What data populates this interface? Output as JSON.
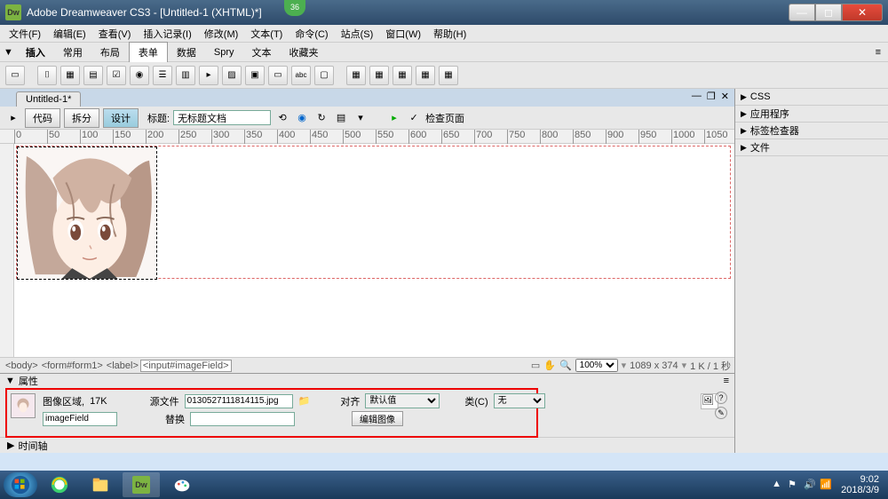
{
  "title": "Adobe Dreamweaver CS3 - [Untitled-1 (XHTML)*]",
  "ribbon_badge": "36",
  "menu": [
    "文件(F)",
    "编辑(E)",
    "查看(V)",
    "插入记录(I)",
    "修改(M)",
    "文本(T)",
    "命令(C)",
    "站点(S)",
    "窗口(W)",
    "帮助(H)"
  ],
  "insert_tabs": {
    "label": "插入",
    "items": [
      "常用",
      "布局",
      "表单",
      "数据",
      "Spry",
      "文本",
      "收藏夹"
    ],
    "active": 2
  },
  "doc_tab": "Untitled-1*",
  "view_buttons": {
    "code": "代码",
    "split": "拆分",
    "design": "设计"
  },
  "doc_toolbar": {
    "title_label": "标题:",
    "title_value": "无标题文档",
    "check_label": "检查页面"
  },
  "ruler_marks": [
    "0",
    "50",
    "100",
    "150",
    "200",
    "250",
    "300",
    "350",
    "400",
    "450",
    "500",
    "550",
    "600",
    "650",
    "700",
    "750",
    "800",
    "850",
    "900",
    "950",
    "1000",
    "1050"
  ],
  "tag_selector": [
    "<body>",
    "<form#form1>",
    "<label>",
    "<input#imageField>"
  ],
  "status": {
    "zoom": "100%",
    "dims": "1089 x 374",
    "extra": "1 K / 1 秒"
  },
  "properties": {
    "header": "属性",
    "area_label": "图像区域,",
    "size": "17K",
    "id_value": "imageField",
    "src_label": "源文件",
    "src_value": "0130527111814115.jpg",
    "alt_label": "替换",
    "alt_value": "",
    "align_label": "对齐",
    "align_value": "默认值",
    "class_label": "类(C)",
    "class_value": "无",
    "edit_button": "编辑图像"
  },
  "timeline": "时间轴",
  "right_panels": [
    "CSS",
    "应用程序",
    "标签检查器",
    "文件"
  ],
  "tray_time": "9:02",
  "tray_date": "2018/3/9"
}
